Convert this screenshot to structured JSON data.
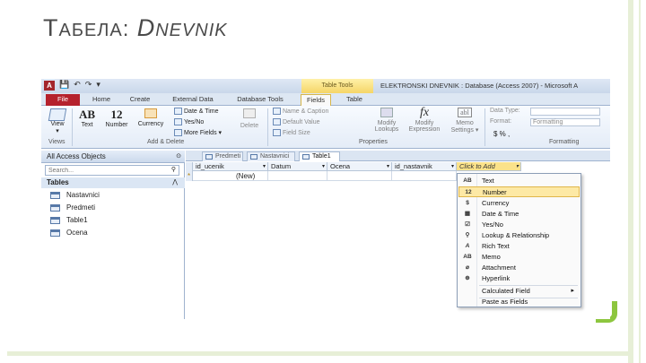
{
  "slide": {
    "title_first": "T",
    "title_rest": "АБЕЛА",
    "title_colon": ":",
    "title_italic_first": "D",
    "title_italic_rest": "NEVNIK"
  },
  "window": {
    "app_icon": "A",
    "quick_access": [
      "💾",
      "↶",
      "↷",
      "▾"
    ],
    "context_group": "Table Tools",
    "title": "ELEKTRONSKI DNEVNIK : Database (Access 2007) - Microsoft A"
  },
  "ribbon_tabs": [
    "File",
    "Home",
    "Create",
    "External Data",
    "Database Tools",
    "Fields",
    "Table"
  ],
  "ribbon": {
    "views": {
      "view_label": "View",
      "view_arrow": "▾",
      "group": "Views"
    },
    "add_delete": {
      "text_glyph": "AB",
      "text_label": "Text",
      "number_glyph": "12",
      "number_label": "Number",
      "currency_label": "Currency",
      "date_time": "Date & Time",
      "yes_no": "Yes/No",
      "more_fields": "More Fields ▾",
      "delete_label": "Delete",
      "group": "Add & Delete"
    },
    "properties": {
      "name_caption": "Name & Caption",
      "default_value": "Default Value",
      "field_size": "Field Size",
      "modify_lookups_1": "Modify",
      "modify_lookups_2": "Lookups",
      "modify_expression_1": "Modify",
      "modify_expression_2": "Expression",
      "memo_settings_1": "Memo",
      "memo_settings_2": "Settings ▾",
      "group": "Properties"
    },
    "formatting": {
      "data_type": "Data Type:",
      "format": "Format:",
      "format_value": "Formatting",
      "symbols": "$   %   ,",
      "group": "Formatting"
    }
  },
  "nav": {
    "header": "All Access Objects",
    "header_chevron": "⊙",
    "search_placeholder": "Search...",
    "section": "Tables",
    "section_chevron": "⋀",
    "items": [
      "Nastavnici",
      "Predmeti",
      "Table1",
      "Ocena"
    ]
  },
  "doc_tabs": [
    "Predmeti",
    "Nastavnici",
    "Table1"
  ],
  "grid": {
    "columns": [
      "id_ucenik",
      "Datum",
      "Ocena",
      "id_nastavnik"
    ],
    "click_to_add": "Click to Add",
    "dropdown_glyph": "▾",
    "new_row_marker": "*",
    "new_row_value": "(New)"
  },
  "menu": {
    "items": [
      {
        "icon": "AB",
        "label": "Text",
        "highlighted": false,
        "submenu": false
      },
      {
        "icon": "12",
        "label": "Number",
        "highlighted": true,
        "submenu": false
      },
      {
        "icon": "$",
        "label": "Currency",
        "highlighted": false,
        "submenu": false
      },
      {
        "icon": "▦",
        "label": "Date & Time",
        "highlighted": false,
        "submenu": false
      },
      {
        "icon": "☑",
        "label": "Yes/No",
        "highlighted": false,
        "submenu": false
      },
      {
        "icon": "⚲",
        "label": "Lookup & Relationship",
        "highlighted": false,
        "submenu": false
      },
      {
        "icon": "A",
        "label": "Rich Text",
        "highlighted": false,
        "submenu": false
      },
      {
        "icon": "AB",
        "label": "Memo",
        "highlighted": false,
        "submenu": false
      },
      {
        "icon": "⌀",
        "label": "Attachment",
        "highlighted": false,
        "submenu": false
      },
      {
        "icon": "⊕",
        "label": "Hyperlink",
        "highlighted": false,
        "submenu": false
      },
      {
        "icon": "",
        "label": "Calculated Field",
        "highlighted": false,
        "submenu": true
      },
      {
        "icon": "",
        "label": "Paste as Fields",
        "highlighted": false,
        "submenu": false
      }
    ],
    "submenu_glyph": "▸"
  },
  "colors": {
    "file_tab": "#b5222d",
    "context_tab": "#f5d567",
    "menu_highlight": "#fde9a5",
    "accent_green": "#8dc63f"
  }
}
